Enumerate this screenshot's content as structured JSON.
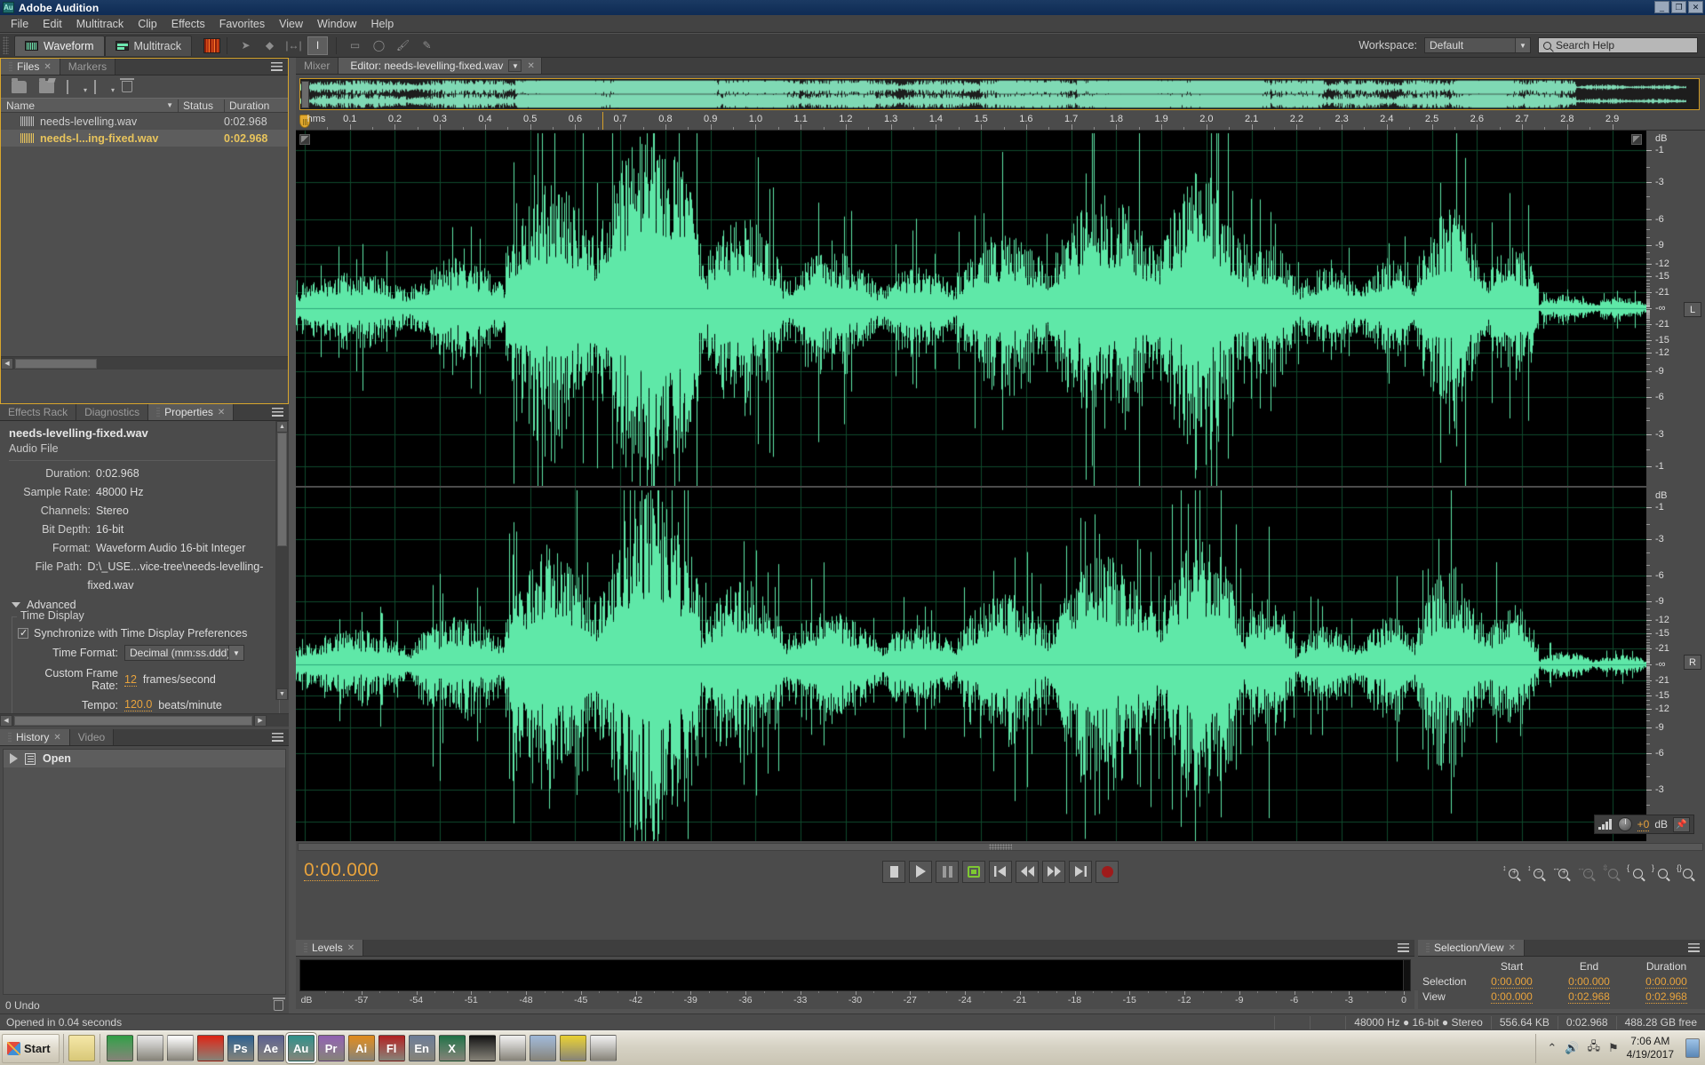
{
  "window": {
    "title": "Adobe Audition",
    "logo_text": "Au",
    "minimize": "_",
    "maximize": "❐",
    "close": "✕"
  },
  "menu": [
    "File",
    "Edit",
    "Multitrack",
    "Clip",
    "Effects",
    "Favorites",
    "View",
    "Window",
    "Help"
  ],
  "toolbar": {
    "waveform_tab": "Waveform",
    "multitrack_tab": "Multitrack",
    "workspace_label": "Workspace:",
    "workspace_value": "Default",
    "search_placeholder": "Search Help"
  },
  "files_panel": {
    "tabs": [
      {
        "label": "Files",
        "closable": true,
        "active": true
      },
      {
        "label": "Markers",
        "closable": false,
        "active": false
      }
    ],
    "columns": {
      "name": "Name",
      "status": "Status",
      "duration": "Duration"
    },
    "rows": [
      {
        "name": "needs-levelling.wav",
        "status": "",
        "duration": "0:02.968",
        "selected": false
      },
      {
        "name": "needs-l...ing-fixed.wav",
        "status": "",
        "duration": "0:02.968",
        "selected": true
      }
    ]
  },
  "properties_panel": {
    "tabs": [
      {
        "label": "Effects Rack",
        "active": false
      },
      {
        "label": "Diagnostics",
        "active": false
      },
      {
        "label": "Properties",
        "active": true
      }
    ],
    "title": "needs-levelling-fixed.wav",
    "subtitle": "Audio File",
    "fields": [
      {
        "label": "Duration:",
        "value": "0:02.968"
      },
      {
        "label": "Sample Rate:",
        "value": "48000 Hz"
      },
      {
        "label": "Channels:",
        "value": "Stereo"
      },
      {
        "label": "Bit Depth:",
        "value": "16-bit"
      },
      {
        "label": "Format:",
        "value": "Waveform Audio 16-bit Integer"
      },
      {
        "label": "File Path:",
        "value": "D:\\_USE...vice-tree\\needs-levelling-fixed.wav"
      }
    ],
    "advanced_label": "Advanced",
    "time_display_group": "Time Display",
    "sync_checkbox_label": "Synchronize with Time Display Preferences",
    "time_format_label": "Time Format:",
    "time_format_value": "Decimal (mm:ss.ddd)",
    "frame_rate_label": "Custom Frame Rate:",
    "frame_rate_value": "12",
    "frame_rate_unit": "frames/second",
    "tempo_label": "Tempo:",
    "tempo_value": "120.0",
    "tempo_unit": "beats/minute"
  },
  "history_panel": {
    "tabs": [
      {
        "label": "History",
        "active": true
      },
      {
        "label": "Video",
        "active": false
      }
    ],
    "items": [
      "Open"
    ],
    "footer": "0 Undo"
  },
  "editor": {
    "tabs": [
      {
        "label": "Mixer",
        "active": false
      },
      {
        "label": "Editor: needs-levelling-fixed.wav",
        "active": true
      }
    ],
    "ruler_origin": "hms",
    "ruler_labels": [
      "0.1",
      "0.2",
      "0.3",
      "0.4",
      "0.5",
      "0.6",
      "0.7",
      "0.8",
      "0.9",
      "1.0",
      "1.1",
      "1.2",
      "1.3",
      "1.4",
      "1.5",
      "1.6",
      "1.7",
      "1.8",
      "1.9",
      "2.0",
      "2.1",
      "2.2",
      "2.3",
      "2.4",
      "2.5",
      "2.6",
      "2.7",
      "2.8",
      "2.9"
    ],
    "db_axis_title": "dB",
    "db_labels_upper": [
      "-1",
      "-3",
      "-6",
      "-9",
      "-12",
      "-15",
      "-21"
    ],
    "db_center": "-∞",
    "db_labels_lower": [
      "-21",
      "-15",
      "-12",
      "-9",
      "-6",
      "-3",
      "-1"
    ],
    "channel_left_badge": "L",
    "channel_right_badge": "R",
    "hud_gain": "+0",
    "hud_gain_unit": "dB",
    "waveform_color": "#5FE8A8",
    "grid_color": "#0F4A2D",
    "background_color": "#000000"
  },
  "transport": {
    "time": "0:00.000",
    "buttons": [
      "stop",
      "play",
      "pause",
      "loop",
      "skip-to-start",
      "rewind",
      "fast-forward",
      "skip-to-end",
      "record"
    ],
    "zoom_buttons": [
      "zoom-in-amplitude",
      "zoom-out-amplitude",
      "zoom-in-time",
      "zoom-out-time",
      "zoom-out-full",
      "zoom-to-selection-in",
      "zoom-to-selection-out",
      "zoom-to-selection"
    ]
  },
  "levels_panel": {
    "tab": "Levels",
    "scale_unit": "dB",
    "scale_labels": [
      "-57",
      "-54",
      "-51",
      "-48",
      "-45",
      "-42",
      "-39",
      "-36",
      "-33",
      "-30",
      "-27",
      "-24",
      "-21",
      "-18",
      "-15",
      "-12",
      "-9",
      "-6",
      "-3",
      "0"
    ]
  },
  "selection_view_panel": {
    "tab": "Selection/View",
    "headers": [
      "Start",
      "End",
      "Duration"
    ],
    "rows": [
      {
        "label": "Selection",
        "start": "0:00.000",
        "end": "0:00.000",
        "duration": "0:00.000"
      },
      {
        "label": "View",
        "start": "0:00.000",
        "end": "0:02.968",
        "duration": "0:02.968"
      }
    ]
  },
  "statusbar": {
    "message": "Opened in 0.04 seconds",
    "audio_info": "48000 Hz ● 16-bit ● Stereo",
    "file_size": "556.64 KB",
    "duration": "0:02.968",
    "disk_free": "488.28 GB free"
  },
  "taskbar": {
    "start_label": "Start",
    "apps": [
      {
        "name": "chrome",
        "label": "",
        "color": "#2f9e44"
      },
      {
        "name": "notepad",
        "label": "",
        "color": "#e8e8e8"
      },
      {
        "name": "picasa",
        "label": "",
        "color": "#ffffff"
      },
      {
        "name": "mathematica",
        "label": "",
        "color": "#dd2211"
      },
      {
        "name": "photoshop",
        "label": "Ps",
        "color": "#2b5f8f"
      },
      {
        "name": "after-effects",
        "label": "Ae",
        "color": "#5a5f8f"
      },
      {
        "name": "audition",
        "label": "Au",
        "color": "#2e8f88"
      },
      {
        "name": "premiere",
        "label": "Pr",
        "color": "#8f5fb0"
      },
      {
        "name": "illustrator",
        "label": "Ai",
        "color": "#e08a1a"
      },
      {
        "name": "flash",
        "label": "Fl",
        "color": "#b01f1f"
      },
      {
        "name": "encore",
        "label": "En",
        "color": "#6b7b95"
      },
      {
        "name": "excel",
        "label": "X",
        "color": "#1e7045"
      },
      {
        "name": "command-prompt",
        "label": "",
        "color": "#101010"
      },
      {
        "name": "document-1",
        "label": "",
        "color": "#f0f0f0"
      },
      {
        "name": "itunes",
        "label": "",
        "color": "#9fb8d8"
      },
      {
        "name": "mindmap",
        "label": "",
        "color": "#e8d030"
      },
      {
        "name": "document-2",
        "label": "",
        "color": "#f0f0f0"
      }
    ],
    "clock_time": "7:06 AM",
    "clock_date": "4/19/2017"
  }
}
